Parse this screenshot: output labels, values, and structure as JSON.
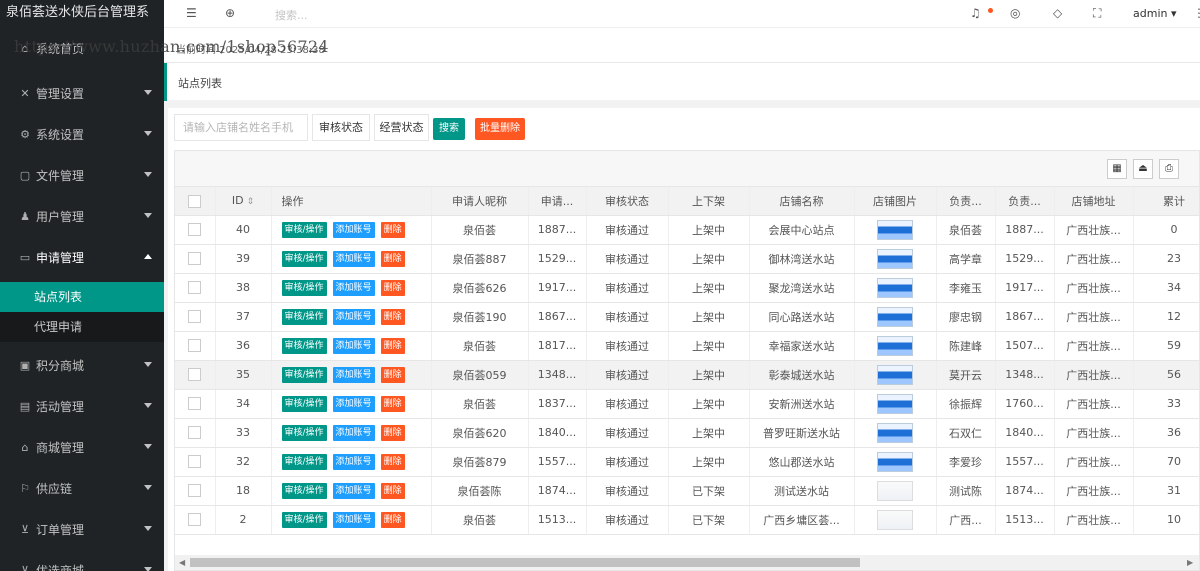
{
  "sidebar": {
    "app_title": "泉佰荟送水侠后台管理系",
    "items": [
      {
        "label": "系统首页",
        "icon": "home-icon"
      },
      {
        "label": "管理设置",
        "icon": "wrench-icon"
      },
      {
        "label": "系统设置",
        "icon": "gear-icon"
      },
      {
        "label": "文件管理",
        "icon": "file-icon"
      },
      {
        "label": "用户管理",
        "icon": "users-icon"
      },
      {
        "label": "申请管理",
        "icon": "form-icon"
      },
      {
        "label": "积分商城",
        "icon": "points-icon"
      },
      {
        "label": "活动管理",
        "icon": "activity-icon"
      },
      {
        "label": "商城管理",
        "icon": "shop-icon"
      },
      {
        "label": "供应链",
        "icon": "flag-icon"
      },
      {
        "label": "订单管理",
        "icon": "cart-icon"
      },
      {
        "label": "优选商城",
        "icon": "cart-icon"
      }
    ],
    "sub_items": [
      "站点列表",
      "代理申请"
    ]
  },
  "header": {
    "search_placeholder": "搜索...",
    "user": "admin"
  },
  "info": {
    "current_time": "当前时间 2025/04/28 23:38:38",
    "watermark": "https://www.huzhan.com/1shop56724"
  },
  "breadcrumb": {
    "title": "站点列表"
  },
  "toolbar": {
    "search_placeholder": "请输入店铺名姓名手机",
    "audit_status": "审核状态",
    "operate_status": "经营状态",
    "search": "搜索",
    "batch_delete": "批量删除"
  },
  "table": {
    "columns": [
      "ID",
      "操作",
      "申请人昵称",
      "申请...",
      "审核状态",
      "上下架",
      "店铺名称",
      "店铺图片",
      "负责...",
      "负责...",
      "店铺地址",
      "累计"
    ],
    "op_labels": {
      "audit": "审核/操作",
      "add_account": "添加账号",
      "delete": "删除"
    },
    "rows": [
      {
        "id": "40",
        "nick": "泉佰荟",
        "phone": "1887...",
        "audit": "审核通过",
        "shelf": "上架中",
        "store": "会展中心站点",
        "leader": "泉佰荟",
        "leader_phone": "1887...",
        "address": "广西壮族...",
        "total": "0"
      },
      {
        "id": "39",
        "nick": "泉佰荟887",
        "phone": "1529...",
        "audit": "审核通过",
        "shelf": "上架中",
        "store": "御林湾送水站",
        "leader": "高学章",
        "leader_phone": "1529...",
        "address": "广西壮族...",
        "total": "23"
      },
      {
        "id": "38",
        "nick": "泉佰荟626",
        "phone": "1917...",
        "audit": "审核通过",
        "shelf": "上架中",
        "store": "聚龙湾送水站",
        "leader": "李雍玉",
        "leader_phone": "1917...",
        "address": "广西壮族...",
        "total": "34"
      },
      {
        "id": "37",
        "nick": "泉佰荟190",
        "phone": "1867...",
        "audit": "审核通过",
        "shelf": "上架中",
        "store": "同心路送水站",
        "leader": "廖忠钢",
        "leader_phone": "1867...",
        "address": "广西壮族...",
        "total": "12"
      },
      {
        "id": "36",
        "nick": "泉佰荟",
        "phone": "1817...",
        "audit": "审核通过",
        "shelf": "上架中",
        "store": "幸福家送水站",
        "leader": "陈建峰",
        "leader_phone": "1507...",
        "address": "广西壮族...",
        "total": "59"
      },
      {
        "id": "35",
        "nick": "泉佰荟059",
        "phone": "1348...",
        "audit": "审核通过",
        "shelf": "上架中",
        "store": "彰泰城送水站",
        "leader": "莫开云",
        "leader_phone": "1348...",
        "address": "广西壮族...",
        "total": "56"
      },
      {
        "id": "34",
        "nick": "泉佰荟",
        "phone": "1837...",
        "audit": "审核通过",
        "shelf": "上架中",
        "store": "安新洲送水站",
        "leader": "徐振辉",
        "leader_phone": "1760...",
        "address": "广西壮族...",
        "total": "33"
      },
      {
        "id": "33",
        "nick": "泉佰荟620",
        "phone": "1840...",
        "audit": "审核通过",
        "shelf": "上架中",
        "store": "普罗旺斯送水站",
        "leader": "石双仁",
        "leader_phone": "1840...",
        "address": "广西壮族...",
        "total": "36"
      },
      {
        "id": "32",
        "nick": "泉佰荟879",
        "phone": "1557...",
        "audit": "审核通过",
        "shelf": "上架中",
        "store": "悠山郡送水站",
        "leader": "李爱珍",
        "leader_phone": "1557...",
        "address": "广西壮族...",
        "total": "70"
      },
      {
        "id": "18",
        "nick": "泉佰荟陈",
        "phone": "1874...",
        "audit": "审核通过",
        "shelf": "已下架",
        "store": "测试送水站",
        "leader": "测试陈",
        "leader_phone": "1874...",
        "address": "广西壮族...",
        "total": "31"
      },
      {
        "id": "2",
        "nick": "泉佰荟",
        "phone": "1513...",
        "audit": "审核通过",
        "shelf": "已下架",
        "store": "广西乡墉区荟...",
        "leader": "广西...",
        "leader_phone": "1513...",
        "address": "广西壮族...",
        "total": "10"
      }
    ]
  },
  "colors": {
    "primary": "#009688",
    "blue": "#1e9fff",
    "danger": "#ff5722",
    "sidebar": "#1f2326"
  }
}
